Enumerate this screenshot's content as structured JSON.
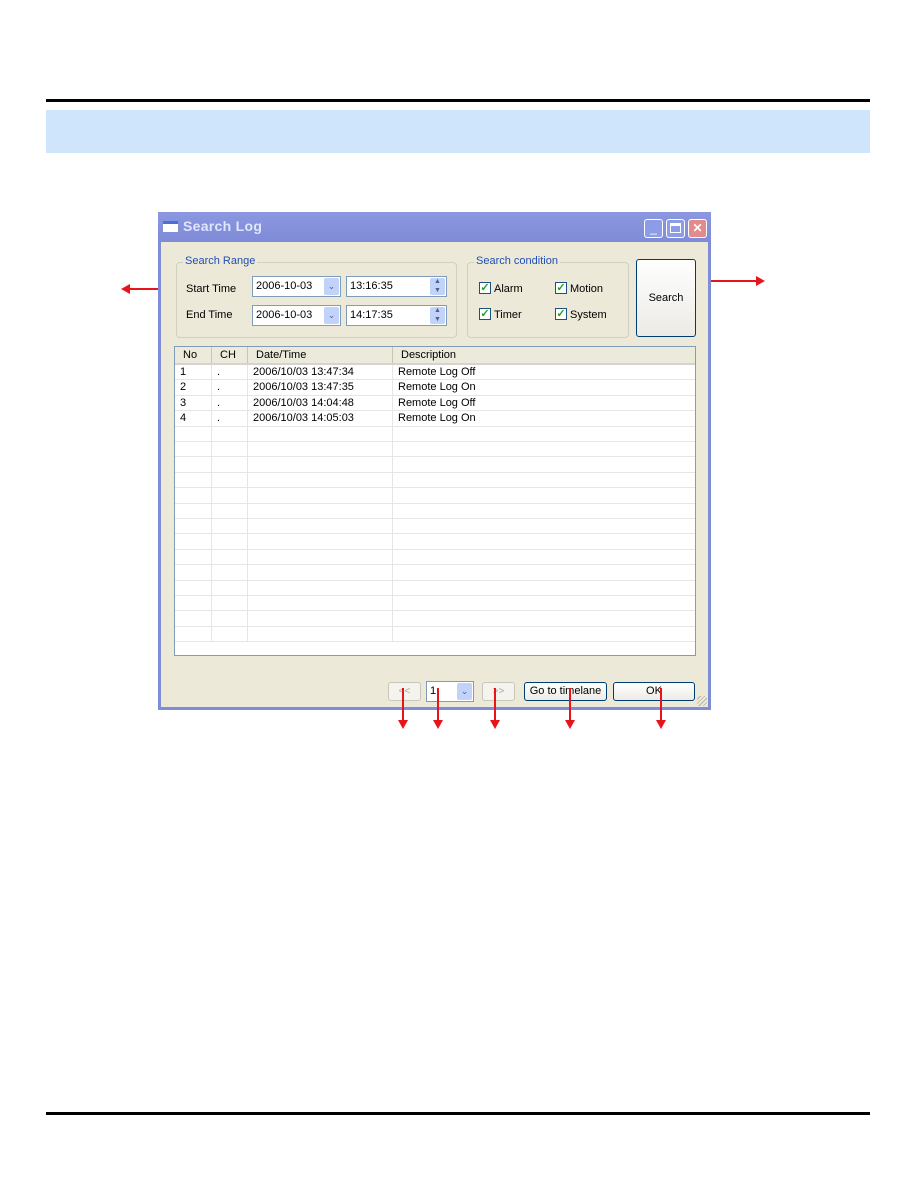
{
  "document": {
    "header_band_text": ""
  },
  "window": {
    "title": "Search Log",
    "controls": {
      "minimize": "_",
      "maximize": "",
      "close": "✕"
    }
  },
  "search_range": {
    "legend": "Search Range",
    "start_label": "Start Time",
    "start_date": "2006-10-03",
    "start_time": "13:16:35",
    "end_label": "End Time",
    "end_date": "2006-10-03",
    "end_time": "14:17:35",
    "dropdown_glyph": "⌄",
    "spin_up_glyph": "▲",
    "spin_down_glyph": "▼"
  },
  "search_condition": {
    "legend": "Search condition",
    "check_glyph": "✓",
    "options": [
      {
        "label": "Alarm",
        "checked": true
      },
      {
        "label": "Motion",
        "checked": true
      },
      {
        "label": "Timer",
        "checked": true
      },
      {
        "label": "System",
        "checked": true
      }
    ]
  },
  "search_button": "Search",
  "log_table": {
    "columns": [
      "No",
      "CH",
      "Date/Time",
      "Description"
    ],
    "rows": [
      {
        "no": "1",
        "ch": ".",
        "datetime": "2006/10/03 13:47:34",
        "description": "Remote Log Off"
      },
      {
        "no": "2",
        "ch": ".",
        "datetime": "2006/10/03 13:47:35",
        "description": "Remote Log On"
      },
      {
        "no": "3",
        "ch": ".",
        "datetime": "2006/10/03 14:04:48",
        "description": "Remote Log Off"
      },
      {
        "no": "4",
        "ch": ".",
        "datetime": "2006/10/03 14:05:03",
        "description": "Remote Log On"
      }
    ],
    "empty_row_count": 14
  },
  "footer": {
    "prev_label": "<<",
    "page_value": "1",
    "next_label": ">>",
    "goto_label": "Go to timelane",
    "ok_label": "OK"
  },
  "annotation_color": "#e8141b"
}
